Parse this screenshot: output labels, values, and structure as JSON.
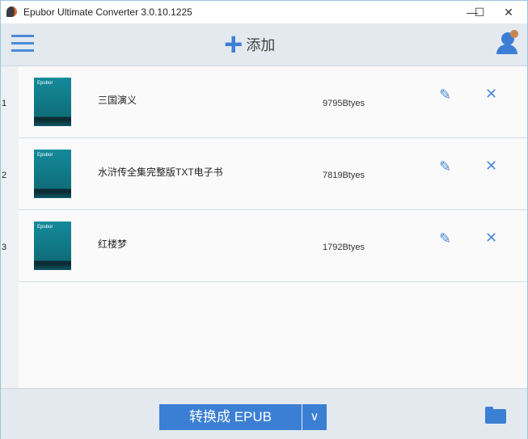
{
  "window": {
    "title": "Epubor Ultimate Converter 3.0.10.1225",
    "minimize": "—",
    "maximize": "☐",
    "close": "✕"
  },
  "toolbar": {
    "add_icon": "+",
    "add_label": "添加"
  },
  "books": [
    {
      "index": "1",
      "title": "三国演义",
      "size": "9795Btyes",
      "cover_text": "Epubor"
    },
    {
      "index": "2",
      "title": "水浒传全集完整版TXT电子书",
      "size": "7819Btyes",
      "cover_text": "Epubor"
    },
    {
      "index": "3",
      "title": "红楼梦",
      "size": "1792Btyes",
      "cover_text": "Epubor"
    }
  ],
  "icons": {
    "edit": "✎",
    "delete": "✕",
    "dropdown": "∨"
  },
  "bottom": {
    "convert_label": "转换成 EPUB"
  },
  "colors": {
    "accent": "#3b7fd4"
  }
}
